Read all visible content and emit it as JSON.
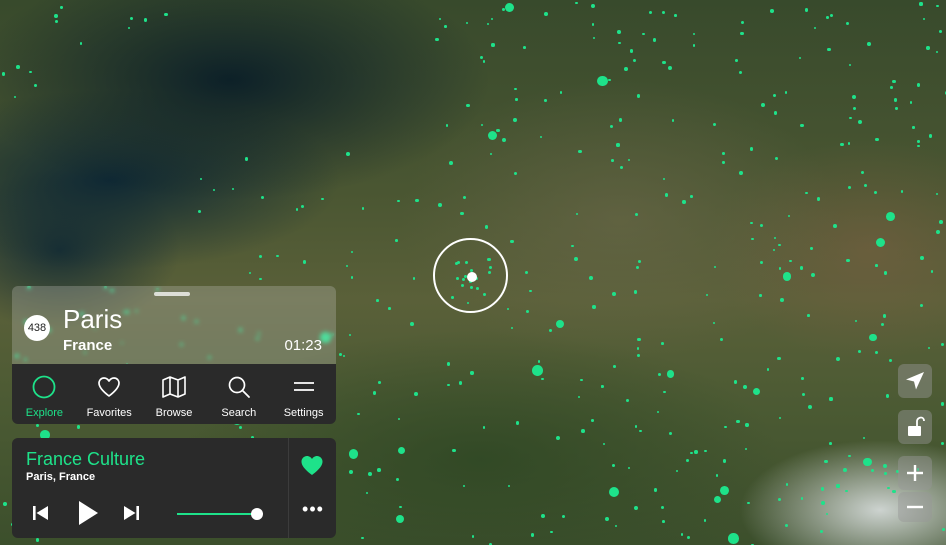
{
  "station_card": {
    "count": "438",
    "city": "Paris",
    "country": "France",
    "time": "01:23"
  },
  "nav": {
    "items": [
      {
        "label": "Explore",
        "icon": "explore-circle-icon",
        "active": true
      },
      {
        "label": "Favorites",
        "icon": "heart-icon",
        "active": false
      },
      {
        "label": "Browse",
        "icon": "map-icon",
        "active": false
      },
      {
        "label": "Search",
        "icon": "search-icon",
        "active": false
      },
      {
        "label": "Settings",
        "icon": "settings-lines-icon",
        "active": false
      }
    ]
  },
  "player": {
    "station_name": "France Culture",
    "location": "Paris, France",
    "favorited": true,
    "volume": 0.9,
    "more_label": "•••"
  },
  "map_controls": [
    {
      "icon": "locate-arrow-icon"
    },
    {
      "icon": "unlock-icon"
    },
    {
      "icon": "zoom-in-icon",
      "label": "+"
    },
    {
      "icon": "zoom-out-icon",
      "label": "−"
    }
  ],
  "colors": {
    "accent": "#1ee28a",
    "panel": "#2a2a2a"
  }
}
